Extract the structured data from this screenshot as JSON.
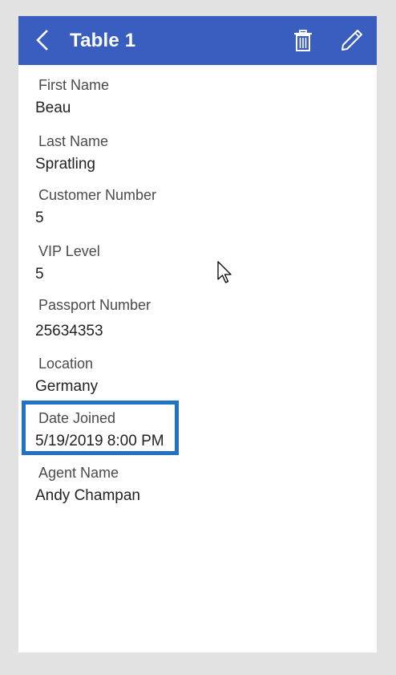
{
  "header": {
    "title": "Table 1",
    "back_icon": "chevron-left-icon",
    "delete_icon": "trash-icon",
    "edit_icon": "pencil-icon",
    "background_color": "#3a5ebf"
  },
  "fields": [
    {
      "label": "First Name",
      "value": "Beau"
    },
    {
      "label": "Last Name",
      "value": "Spratling"
    },
    {
      "label": "Customer Number",
      "value": "5"
    },
    {
      "label": "VIP Level",
      "value": "5"
    },
    {
      "label": "Passport Number",
      "value": "25634353"
    },
    {
      "label": "Location",
      "value": "Germany"
    },
    {
      "label": "Date Joined",
      "value": "5/19/2019 8:00 PM"
    },
    {
      "label": "Agent Name",
      "value": "Andy Champan"
    }
  ],
  "highlight": {
    "field": "Date Joined",
    "color": "#1f73c6"
  }
}
